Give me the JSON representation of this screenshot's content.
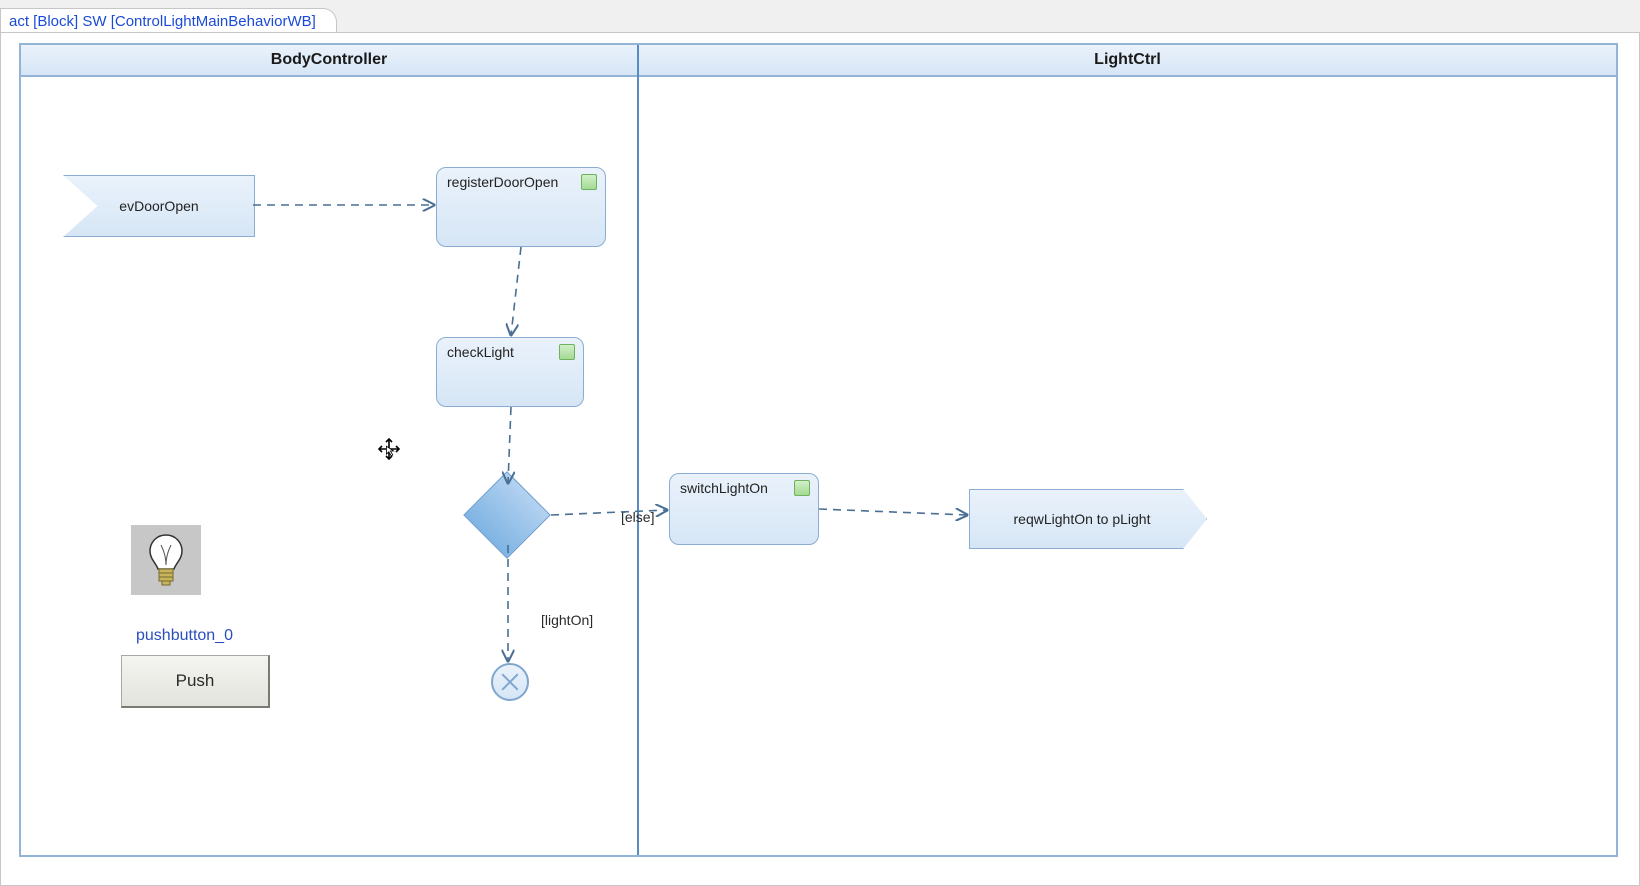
{
  "tab_title": "act [Block] SW [ControlLightMainBehaviorWB]",
  "swimlanes": {
    "left": "BodyController",
    "right": "LightCtrl"
  },
  "nodes": {
    "evDoorOpen": "evDoorOpen",
    "registerDoorOpen": "registerDoorOpen",
    "checkLight": "checkLight",
    "switchLightOn": "switchLightOn",
    "sendSignal": "reqwLightOn to pLight"
  },
  "guards": {
    "else": "[else]",
    "lightOn": "[lightOn]"
  },
  "widget": {
    "name": "pushbutton_0",
    "button_label": "Push"
  }
}
